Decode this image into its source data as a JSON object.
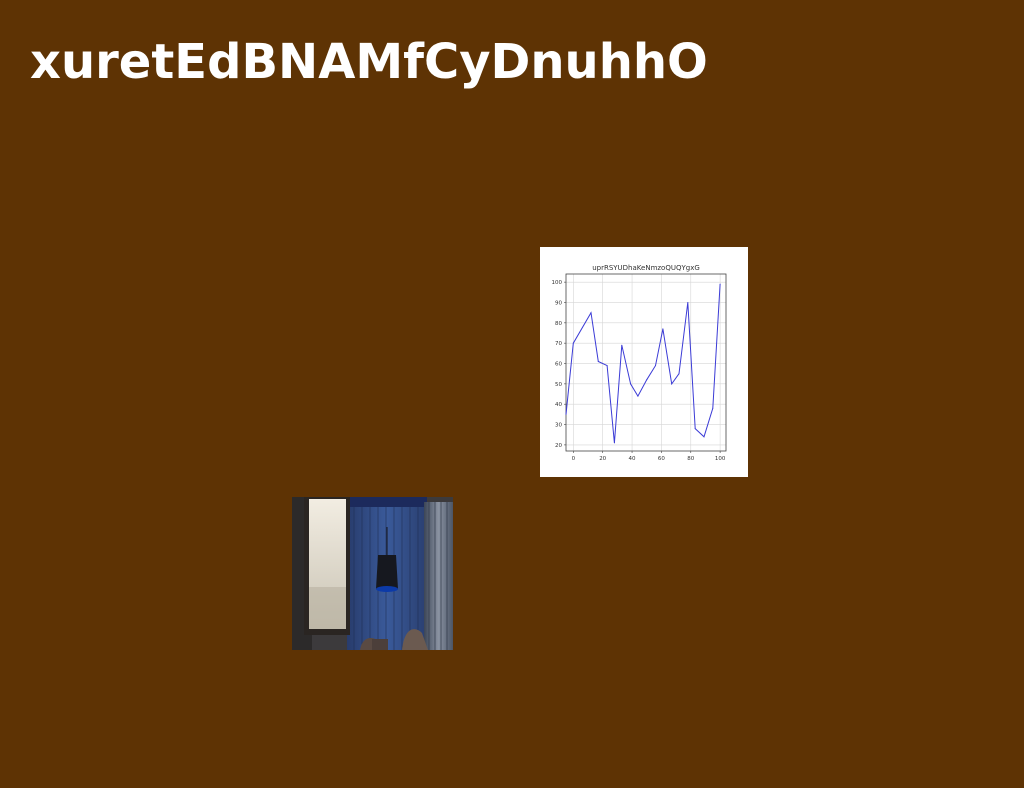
{
  "page": {
    "title": "xuretEdBNAMfCyDnuhhO",
    "background_color": "#5e3304"
  },
  "chart_data": {
    "type": "line",
    "title": "uprRSYUDhaKeNmzoQUQYgxG",
    "xlabel": "",
    "ylabel": "",
    "xlim": [
      -5,
      104
    ],
    "ylim": [
      17,
      104
    ],
    "grid": true,
    "x_ticks": [
      0,
      20,
      40,
      60,
      80,
      100
    ],
    "y_ticks": [
      20,
      30,
      40,
      50,
      60,
      70,
      80,
      90,
      100
    ],
    "line_color": "#3b3bd6",
    "series": [
      {
        "x": [
          -5,
          0,
          12,
          17,
          23,
          28,
          33,
          39,
          44,
          50,
          56,
          61,
          67,
          72,
          78,
          83,
          89,
          95,
          100
        ],
        "y": [
          35,
          70,
          85,
          61,
          59,
          21,
          69,
          50,
          44,
          52,
          59,
          77,
          50,
          55,
          90,
          28,
          24,
          38,
          99
        ]
      }
    ]
  },
  "photo": {
    "subject": "room-interior-with-blue-wall-and-window",
    "colors": {
      "wall": "#2d4a86",
      "window": "#e8e2d4",
      "shade": "#1a2033",
      "curtain": "#5c6b80"
    }
  }
}
